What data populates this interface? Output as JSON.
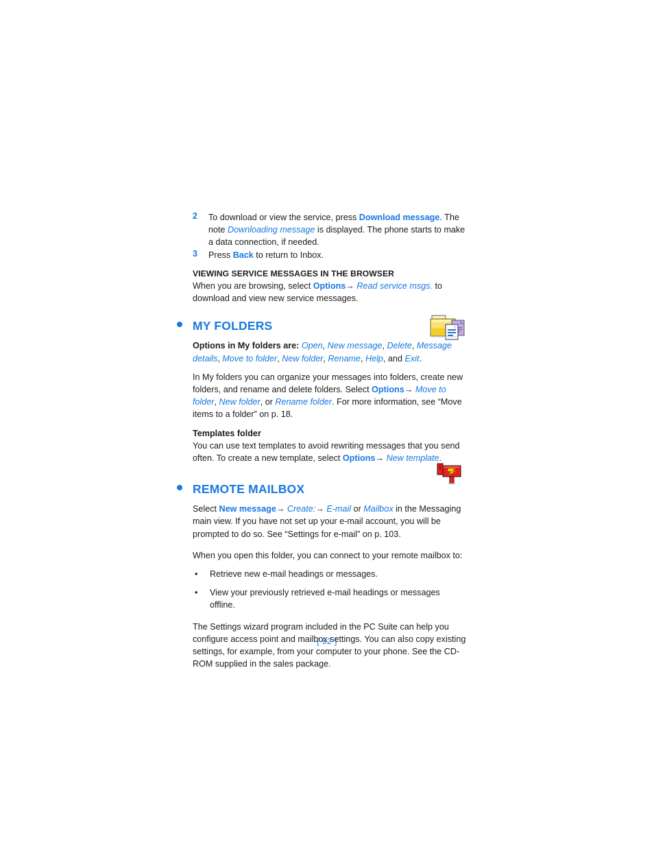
{
  "document": {
    "page_number": "[ 92 ]"
  },
  "steps": [
    {
      "number": "2",
      "parts": [
        {
          "text": "To download or view the service, press ",
          "style": "plain"
        },
        {
          "text": "Download message",
          "style": "blue-bold"
        },
        {
          "text": ". The note ",
          "style": "plain"
        },
        {
          "text": "Downloading message",
          "style": "blue-italic"
        },
        {
          "text": " is displayed. The phone starts to make a data connection, if needed.",
          "style": "plain"
        }
      ]
    },
    {
      "number": "3",
      "parts": [
        {
          "text": "Press ",
          "style": "plain"
        },
        {
          "text": "Back",
          "style": "blue-bold"
        },
        {
          "text": " to return to Inbox.",
          "style": "plain"
        }
      ]
    }
  ],
  "browser_section": {
    "heading": "VIEWING SERVICE MESSAGES IN THE BROWSER",
    "body": {
      "lead": "When you are browsing, select ",
      "options_label": "Options",
      "arrow": "→",
      "command": "Read service msgs.",
      "tail": " to download and view new service messages."
    }
  },
  "my_folders": {
    "bullet": "•",
    "title": "MY FOLDERS",
    "icon": "my-folders-icon",
    "options_intro": "Options in My folders are: ",
    "options_list": [
      "Open",
      "New message",
      "Delete",
      "Message details",
      "Move to folder",
      "New folder",
      "Rename",
      "Help"
    ],
    "options_conjunction": ", and ",
    "options_last": "Exit",
    "options_period": ".",
    "paragraph": {
      "lead": "In My folders you can organize your messages into folders, create new folders, and rename and delete folders. Select ",
      "options_label": "Options",
      "arrow": "→",
      "cmd1": "Move to folder",
      "sep1": ", ",
      "cmd2": "New folder",
      "sep2": ", or ",
      "cmd3": "Rename folder",
      "tail": ". For more information, see “Move items to a folder” on p. 18."
    },
    "templates": {
      "heading": "Templates folder",
      "lead": "You can use text templates to avoid rewriting messages that you send often. To create a new template, select ",
      "options_label": "Options",
      "arrow": "→",
      "command": "New template",
      "tail": "."
    }
  },
  "remote_mailbox": {
    "bullet": "•",
    "title": "REMOTE MAILBOX",
    "icon": "remote-mailbox-icon",
    "intro": {
      "lead": "Select ",
      "new_message": "New message",
      "arrow1": "→",
      "create": "Create:",
      "arrow2": "→",
      "email": "E-mail",
      "or": " or ",
      "mailbox": "Mailbox",
      "tail": " in the Messaging main view. If you have not set up your e-mail account, you will be prompted to do so. See “Settings for e-mail” on p. 103."
    },
    "connect_lead": "When you open this folder, you can connect to your remote mailbox to:",
    "bullet_marker": "•",
    "bullets": [
      "Retrieve new e-mail headings or messages.",
      "View your previously retrieved e-mail headings or messages offline."
    ],
    "closing": "The Settings wizard program included in the PC Suite can help you configure access point and mailbox settings. You can also copy existing settings, for example, from your computer to your phone. See the CD-ROM supplied in the sales package."
  },
  "colors": {
    "accent_blue": "#1878e0",
    "text_black": "#1a1a1a",
    "folder_yellow": "#f5d130",
    "mailbox_red": "#e02020",
    "bolt_yellow": "#ffe000"
  }
}
